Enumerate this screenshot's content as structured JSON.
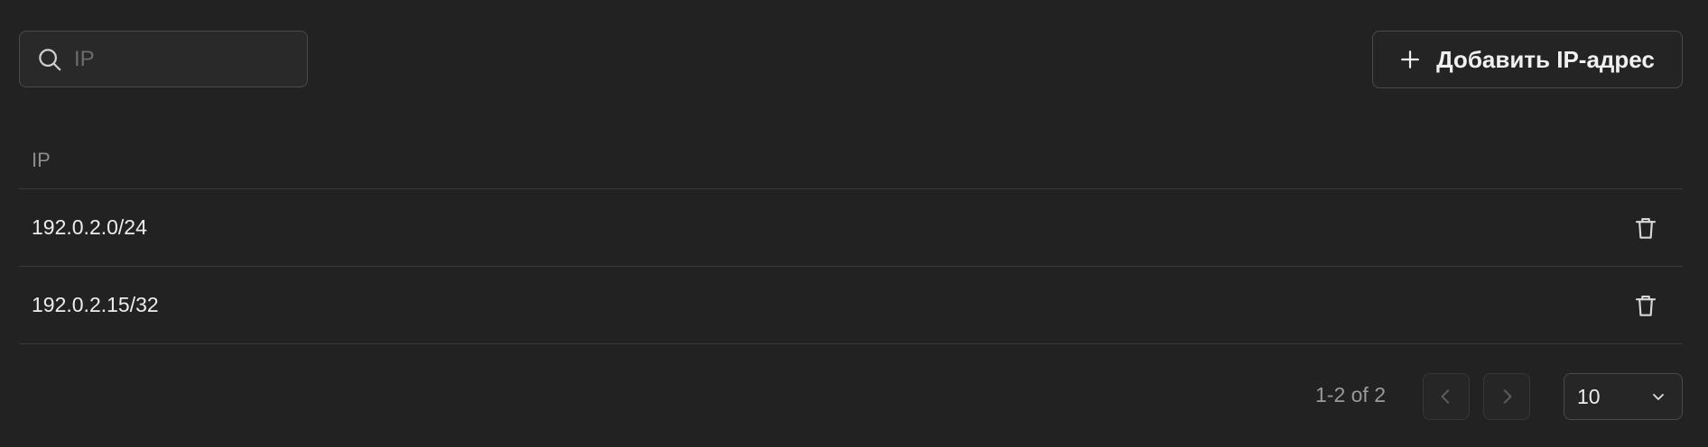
{
  "search": {
    "placeholder": "IP",
    "value": ""
  },
  "toolbar": {
    "add_label": "Добавить IP-адрес"
  },
  "table": {
    "columns": [
      "IP"
    ],
    "rows": [
      {
        "ip": "192.0.2.0/24"
      },
      {
        "ip": "192.0.2.15/32"
      }
    ]
  },
  "pagination": {
    "range_text": "1-2 of 2",
    "page_size": "10"
  },
  "icons": {
    "search": "search-icon",
    "add": "plus-icon",
    "delete": "trash-icon",
    "prev": "chevron-left-icon",
    "next": "chevron-right-icon",
    "dropdown": "chevron-down-icon"
  },
  "colors": {
    "background": "#222222",
    "border": "#4a4a4a",
    "text": "#e8e8e8",
    "muted": "#8d8d8d"
  }
}
